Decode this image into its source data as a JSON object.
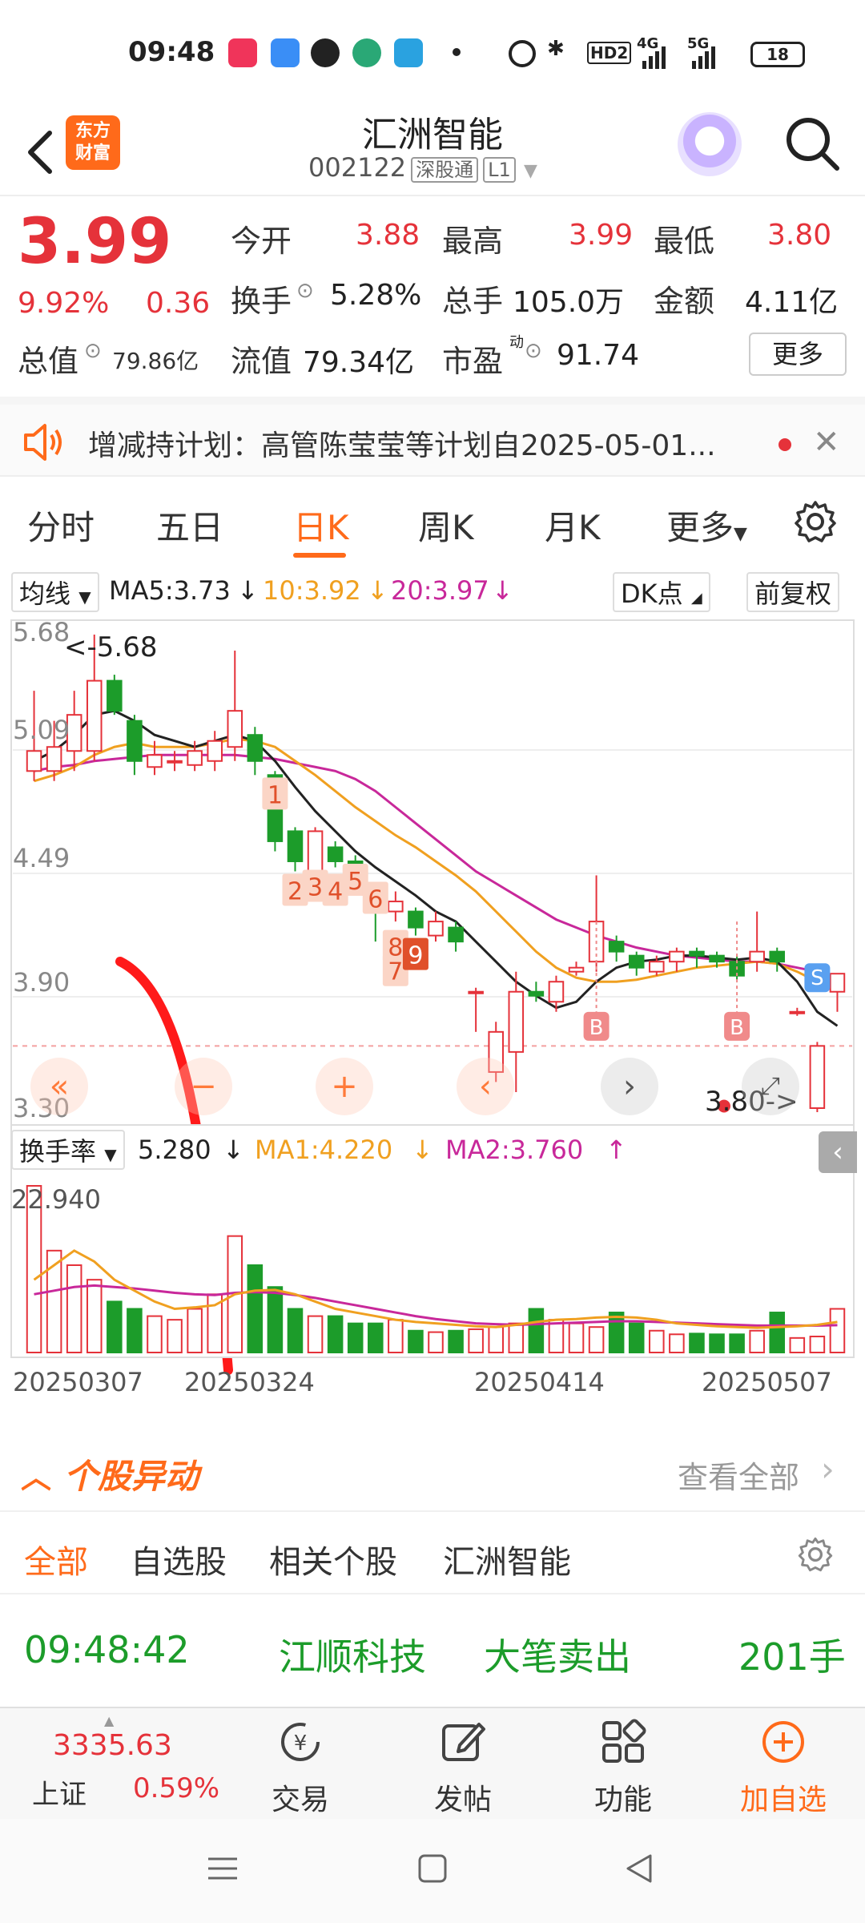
{
  "status_bar": {
    "time": "09:48",
    "network": "4G",
    "network2": "5G",
    "hd": "HD2",
    "battery": "18"
  },
  "header": {
    "logo_text": "东方\n财富",
    "stock_name": "汇洲智能",
    "stock_code": "002122",
    "tag_connect": "深股通",
    "tag_level": "L1"
  },
  "quote": {
    "price": "3.99",
    "change_pct": "9.92%",
    "change_amt": "0.36",
    "market_cap_label": "总值",
    "market_cap": "79.86亿",
    "fields": {
      "open_label": "今开",
      "open": "3.88",
      "high_label": "最高",
      "high": "3.99",
      "low_label": "最低",
      "low": "3.80",
      "turnover_label": "换手",
      "turnover": "5.28%",
      "volume_label": "总手",
      "volume": "105.0万",
      "amount_label": "金额",
      "amount": "4.11亿",
      "float_cap_label": "流值",
      "float_cap": "79.34亿",
      "pe_label": "市盈",
      "pe_sup": "动",
      "pe": "91.74"
    },
    "more_button": "更多"
  },
  "notice": {
    "text": "增减持计划：高管陈莹莹等计划自2025-05-01..."
  },
  "tabs": [
    {
      "label": "分时"
    },
    {
      "label": "五日"
    },
    {
      "label": "日K",
      "active": true
    },
    {
      "label": "周K"
    },
    {
      "label": "月K"
    },
    {
      "label": "更多"
    }
  ],
  "chart": {
    "indicator_select": "均线",
    "ma5": "MA5:3.73",
    "ma10": "10:3.92",
    "ma20": "20:3.97",
    "dk_button": "DK点",
    "adjust_button": "前复权",
    "y_labels": [
      "5.68",
      "5.09",
      "4.49",
      "3.90",
      "3.30"
    ],
    "high_marker": "<-5.68",
    "low_marker": "3.80->",
    "sub_select": "换手率",
    "sub_value": "5.280",
    "sub_ma1": "MA1:4.220",
    "sub_ma2": "MA2:3.760",
    "sub_top": "22.940",
    "x_labels": [
      "20250307",
      "20250324",
      "20250414",
      "20250507"
    ],
    "signals_red": [
      "1",
      "2",
      "3",
      "4",
      "5",
      "6",
      "7",
      "8"
    ],
    "signal_red_solid": "9",
    "signal_b": "B",
    "signal_s": "S",
    "colors": {
      "up": "#e5323a",
      "down": "#1c9c2a",
      "ma5": "#222222",
      "ma10": "#f0a020",
      "ma20": "#c8289a"
    }
  },
  "chart_data": {
    "type": "candlestick",
    "title": "",
    "ylim": [
      3.3,
      5.68
    ],
    "x_labels": [
      "20250307",
      "20250324",
      "20250414",
      "20250507"
    ],
    "candles": [
      {
        "o": 5.0,
        "c": 5.1,
        "h": 5.4,
        "l": 4.95
      },
      {
        "o": 5.0,
        "c": 5.12,
        "h": 5.25,
        "l": 4.95
      },
      {
        "o": 5.1,
        "c": 5.28,
        "h": 5.4,
        "l": 5.0
      },
      {
        "o": 5.1,
        "c": 5.45,
        "h": 5.68,
        "l": 5.05
      },
      {
        "o": 5.45,
        "c": 5.3,
        "h": 5.48,
        "l": 5.28
      },
      {
        "o": 5.25,
        "c": 5.05,
        "h": 5.28,
        "l": 4.98
      },
      {
        "o": 5.02,
        "c": 5.08,
        "h": 5.15,
        "l": 4.98
      },
      {
        "o": 5.05,
        "c": 5.05,
        "h": 5.1,
        "l": 5.0
      },
      {
        "o": 5.03,
        "c": 5.1,
        "h": 5.15,
        "l": 5.0
      },
      {
        "o": 5.05,
        "c": 5.15,
        "h": 5.2,
        "l": 5.0
      },
      {
        "o": 5.12,
        "c": 5.3,
        "h": 5.6,
        "l": 5.05
      },
      {
        "o": 5.18,
        "c": 5.05,
        "h": 5.22,
        "l": 4.98
      },
      {
        "o": 4.98,
        "c": 4.65,
        "h": 5.0,
        "l": 4.6
      },
      {
        "o": 4.7,
        "c": 4.55,
        "h": 4.72,
        "l": 4.5
      },
      {
        "o": 4.5,
        "c": 4.7,
        "h": 4.72,
        "l": 4.48
      },
      {
        "o": 4.62,
        "c": 4.55,
        "h": 4.65,
        "l": 4.52
      },
      {
        "o": 4.55,
        "c": 4.45,
        "h": 4.58,
        "l": 4.4
      },
      {
        "o": 4.4,
        "c": 4.3,
        "h": 4.42,
        "l": 4.15
      },
      {
        "o": 4.3,
        "c": 4.35,
        "h": 4.4,
        "l": 4.25
      },
      {
        "o": 4.3,
        "c": 4.22,
        "h": 4.32,
        "l": 4.18
      },
      {
        "o": 4.18,
        "c": 4.25,
        "h": 4.3,
        "l": 4.15
      },
      {
        "o": 4.22,
        "c": 4.15,
        "h": 4.25,
        "l": 4.1
      },
      {
        "o": 3.9,
        "c": 3.9,
        "h": 3.92,
        "l": 3.7
      },
      {
        "o": 3.5,
        "c": 3.7,
        "h": 3.75,
        "l": 3.45
      },
      {
        "o": 3.6,
        "c": 3.9,
        "h": 4.0,
        "l": 3.4
      },
      {
        "o": 3.9,
        "c": 3.88,
        "h": 3.95,
        "l": 3.85
      },
      {
        "o": 3.85,
        "c": 3.95,
        "h": 3.98,
        "l": 3.8
      },
      {
        "o": 4.0,
        "c": 4.02,
        "h": 4.05,
        "l": 3.98
      },
      {
        "o": 4.05,
        "c": 4.25,
        "h": 4.48,
        "l": 4.0
      },
      {
        "o": 4.15,
        "c": 4.1,
        "h": 4.18,
        "l": 4.05
      },
      {
        "o": 4.08,
        "c": 4.02,
        "h": 4.1,
        "l": 3.98
      },
      {
        "o": 4.0,
        "c": 4.05,
        "h": 4.08,
        "l": 3.98
      },
      {
        "o": 4.05,
        "c": 4.1,
        "h": 4.12,
        "l": 4.0
      },
      {
        "o": 4.1,
        "c": 4.08,
        "h": 4.12,
        "l": 4.02
      },
      {
        "o": 4.08,
        "c": 4.05,
        "h": 4.1,
        "l": 4.02
      },
      {
        "o": 4.05,
        "c": 3.98,
        "h": 4.08,
        "l": 3.96
      },
      {
        "o": 4.05,
        "c": 4.1,
        "h": 4.3,
        "l": 4.0
      },
      {
        "o": 4.1,
        "c": 4.05,
        "h": 4.12,
        "l": 4.0
      },
      {
        "o": 3.8,
        "c": 3.8,
        "h": 3.82,
        "l": 3.78
      },
      {
        "o": 3.32,
        "c": 3.63,
        "h": 3.65,
        "l": 3.3
      },
      {
        "o": 3.9,
        "c": 3.99,
        "h": 3.99,
        "l": 3.8
      }
    ],
    "ma5": [
      5.05,
      5.1,
      5.18,
      5.28,
      5.3,
      5.25,
      5.18,
      5.15,
      5.12,
      5.15,
      5.18,
      5.15,
      5.05,
      4.92,
      4.8,
      4.7,
      4.6,
      4.52,
      4.45,
      4.38,
      4.3,
      4.25,
      4.15,
      4.05,
      3.95,
      3.88,
      3.82,
      3.85,
      3.95,
      4.02,
      4.05,
      4.06,
      4.08,
      4.08,
      4.07,
      4.06,
      4.07,
      4.05,
      3.95,
      3.8,
      3.73
    ],
    "ma10": [
      4.95,
      4.98,
      5.02,
      5.08,
      5.12,
      5.14,
      5.12,
      5.12,
      5.12,
      5.14,
      5.16,
      5.15,
      5.12,
      5.05,
      4.98,
      4.9,
      4.82,
      4.75,
      4.68,
      4.62,
      4.55,
      4.48,
      4.4,
      4.3,
      4.2,
      4.1,
      4.02,
      3.97,
      3.95,
      3.95,
      3.96,
      3.98,
      4.0,
      4.02,
      4.03,
      4.04,
      4.05,
      4.04,
      4.0,
      3.95,
      3.92
    ],
    "ma20": [
      5.0,
      5.02,
      5.03,
      5.05,
      5.06,
      5.07,
      5.08,
      5.08,
      5.08,
      5.08,
      5.08,
      5.07,
      5.06,
      5.04,
      5.02,
      5.0,
      4.96,
      4.9,
      4.82,
      4.74,
      4.66,
      4.58,
      4.5,
      4.44,
      4.38,
      4.32,
      4.26,
      4.22,
      4.18,
      4.15,
      4.12,
      4.1,
      4.08,
      4.07,
      4.06,
      4.05,
      4.05,
      4.04,
      4.02,
      4.0,
      3.97
    ],
    "turnover": [
      22.9,
      14.0,
      12.0,
      10.0,
      7.0,
      6.0,
      5.0,
      4.5,
      6.0,
      8.0,
      16.0,
      12.0,
      9.0,
      6.0,
      5.0,
      5.0,
      4.0,
      4.0,
      4.5,
      3.0,
      2.8,
      3.0,
      3.2,
      3.5,
      4.0,
      6.0,
      4.5,
      4.0,
      3.5,
      5.5,
      4.0,
      3.0,
      2.5,
      2.6,
      2.5,
      2.5,
      3.0,
      5.5,
      2.0,
      2.2,
      6.0
    ],
    "turnover_ma1": [
      10.0,
      12.0,
      14.0,
      12.5,
      10.0,
      8.5,
      7.0,
      6.0,
      6.2,
      6.5,
      8.0,
      8.5,
      8.6,
      8.0,
      7.0,
      6.0,
      5.5,
      5.0,
      4.5,
      4.2,
      4.0,
      3.8,
      3.6,
      3.5,
      3.8,
      4.2,
      4.5,
      4.6,
      4.8,
      4.9,
      4.8,
      4.5,
      4.0,
      3.8,
      3.6,
      3.5,
      3.4,
      3.5,
      3.6,
      3.8,
      4.2
    ],
    "turnover_ma2": [
      8.0,
      8.5,
      9.0,
      9.2,
      9.0,
      8.8,
      8.5,
      8.2,
      8.0,
      7.9,
      8.2,
      8.3,
      8.2,
      7.9,
      7.5,
      7.0,
      6.5,
      6.0,
      5.5,
      5.0,
      4.6,
      4.3,
      4.0,
      3.9,
      3.8,
      3.9,
      4.0,
      4.1,
      4.2,
      4.3,
      4.3,
      4.2,
      4.1,
      4.0,
      3.9,
      3.8,
      3.7,
      3.7,
      3.7,
      3.7,
      3.76
    ]
  },
  "yidong": {
    "title": "个股异动",
    "view_all": "查看全部"
  },
  "filters": [
    {
      "label": "全部",
      "active": true
    },
    {
      "label": "自选股"
    },
    {
      "label": "相关个股"
    },
    {
      "label": "汇洲智能"
    }
  ],
  "feed": {
    "time": "09:48:42",
    "stock": "江顺科技",
    "event": "大笔卖出",
    "qty": "201手"
  },
  "bottom_nav": {
    "index_value": "3335.63",
    "index_name": "上证",
    "index_change": "0.59%",
    "trade": "交易",
    "post": "发帖",
    "features": "功能",
    "add_watch": "加自选"
  }
}
